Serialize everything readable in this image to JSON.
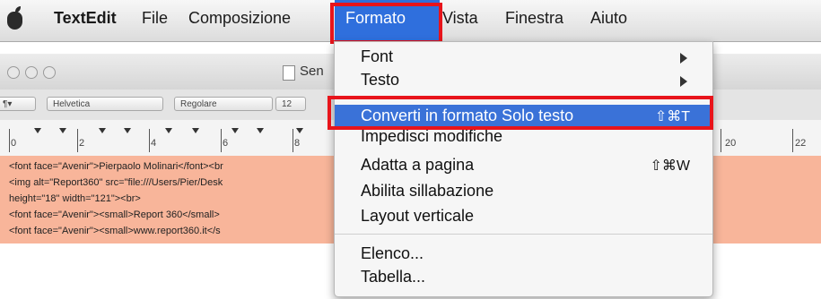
{
  "menubar": {
    "app_name": "TextEdit",
    "items": [
      "File",
      "Composizione",
      "Formato",
      "Vista",
      "Finestra",
      "Aiuto"
    ]
  },
  "window": {
    "title": "Sen",
    "toolbar": {
      "paragraph_control": "¶▾",
      "font_family": "Helvetica",
      "font_style": "Regolare",
      "font_size": "12"
    },
    "ruler_labels": [
      "0",
      "2",
      "4",
      "6",
      "8",
      "20",
      "22"
    ],
    "document_lines": [
      "<font face=\"Avenir\">Pierpaolo Molinari</font><br",
      "<img alt=\"Report360\" src=\"file:///Users/Pier/Desk",
      " height=\"18\" width=\"121\"><br>",
      "<font face=\"Avenir\"><small>Report 360</small>",
      "<font face=\"Avenir\"><small>www.report360.it</s"
    ]
  },
  "dropdown": {
    "font": "Font",
    "testo": "Testo",
    "converti": "Converti in formato Solo testo",
    "converti_shortcut": "⇧⌘T",
    "impedisci": "Impedisci modifiche",
    "adatta": "Adatta a pagina",
    "adatta_shortcut": "⇧⌘W",
    "sillabazione": "Abilita sillabazione",
    "layout": "Layout verticale",
    "elenco": "Elenco...",
    "tabella": "Tabella..."
  }
}
